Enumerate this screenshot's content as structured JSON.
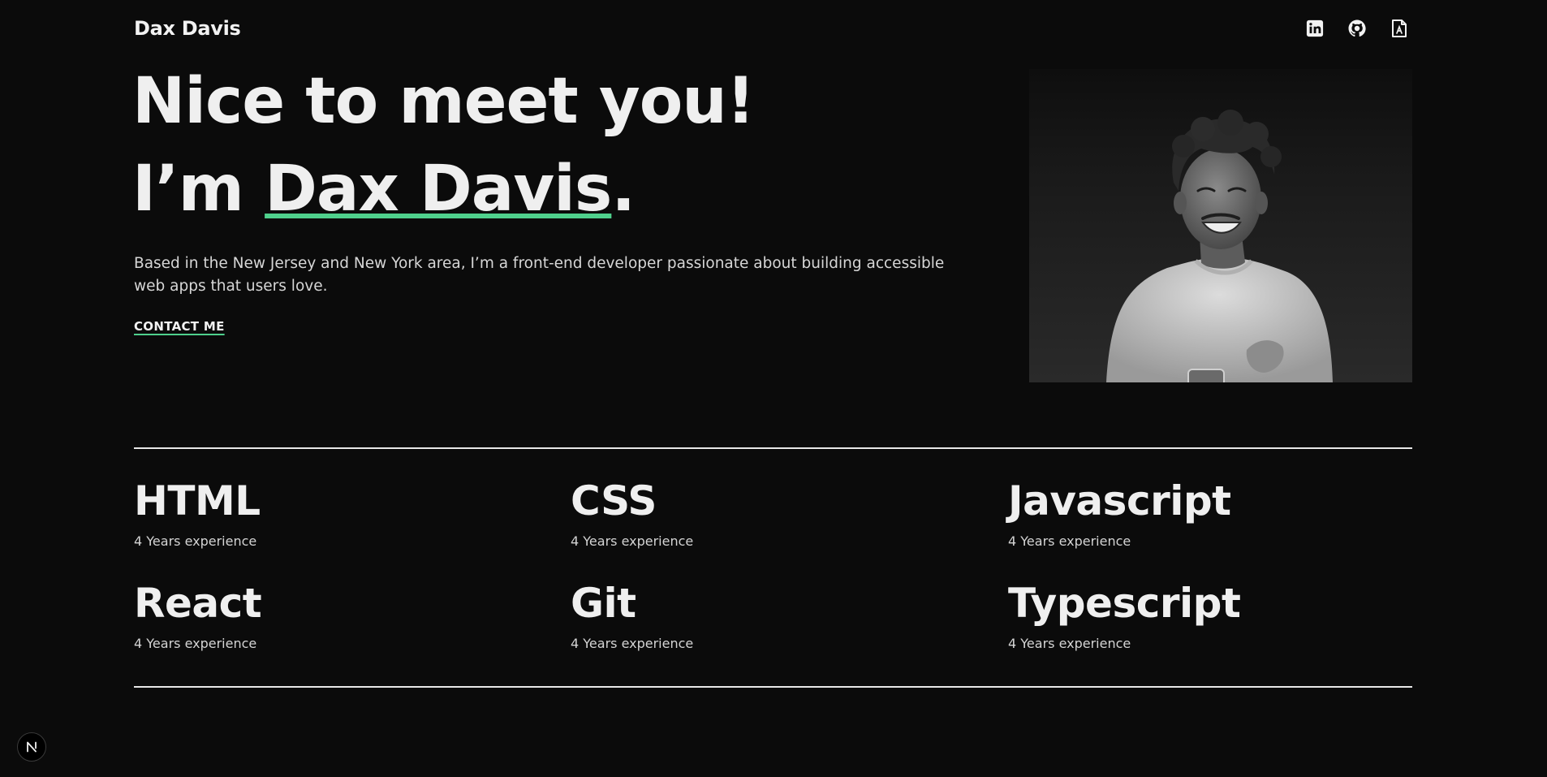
{
  "header": {
    "brand": "Dax Davis",
    "social_icons": [
      "linkedin-icon",
      "github-icon",
      "resume-document-icon"
    ]
  },
  "hero": {
    "line1": "Nice to meet you!",
    "line2_prefix": "I’m ",
    "line2_name": "Dax Davis",
    "line2_suffix": ".",
    "intro": "Based in the New Jersey and New York area, I’m a front-end developer passionate about building accessible web apps that users love.",
    "contact_label": "CONTACT ME",
    "accent_color": "#4fd08c",
    "portrait_description": "grayscale-photo-smiling-person"
  },
  "skills": [
    {
      "name": "HTML",
      "experience": "4 Years experience"
    },
    {
      "name": "CSS",
      "experience": "4 Years experience"
    },
    {
      "name": "Javascript",
      "experience": "4 Years experience"
    },
    {
      "name": "React",
      "experience": "4 Years experience"
    },
    {
      "name": "Git",
      "experience": "4 Years experience"
    },
    {
      "name": "Typescript",
      "experience": "4 Years experience"
    }
  ],
  "dev_badge": {
    "letter": "N",
    "icon": "nextjs-devtools-icon"
  }
}
